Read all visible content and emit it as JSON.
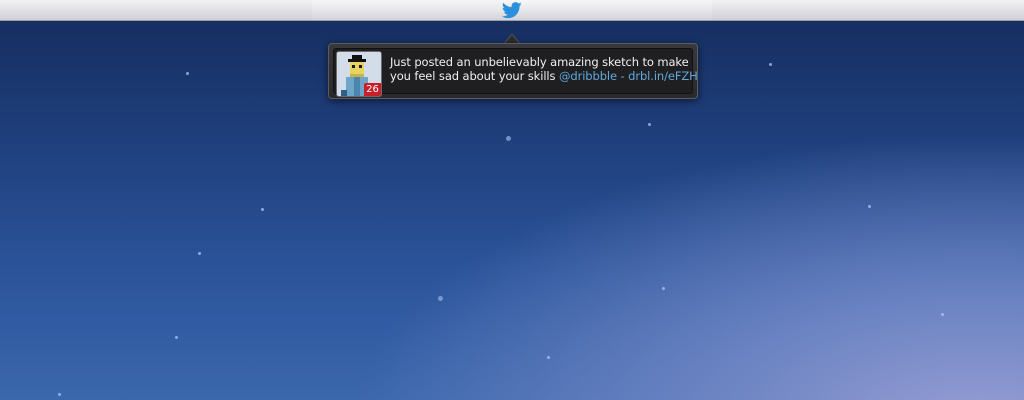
{
  "menubar": {
    "status_icon": "twitter-bird-icon",
    "icon_color": "#2b8fdc"
  },
  "notification": {
    "avatar_icon": "pixel-art-avatar",
    "unread_count": "26",
    "badge_color": "#c8202a",
    "message_text": "Just posted an unbelievably amazing sketch to make you feel sad about your skills ",
    "mention": "@dribbble",
    "separator": " - ",
    "link": "drbl.in/eFZH",
    "link_color": "#5ea9dd"
  },
  "desktop": {
    "wallpaper": "starry-blue-night-sky"
  }
}
